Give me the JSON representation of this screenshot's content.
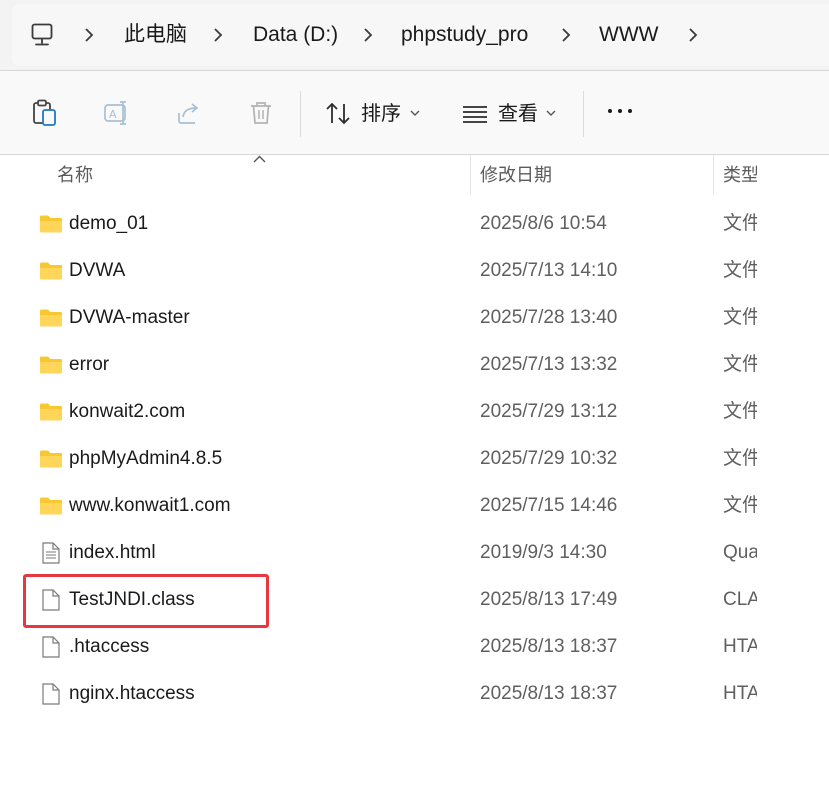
{
  "breadcrumb": {
    "items": [
      "此电脑",
      "Data (D:)",
      "phpstudy_pro",
      "WWW"
    ]
  },
  "toolbar": {
    "sort_label": "排序",
    "view_label": "查看"
  },
  "columns": {
    "name": "名称",
    "modified": "修改日期",
    "type": "类型"
  },
  "files": [
    {
      "name": "demo_01",
      "modified": "2025/8/6 10:54",
      "type": "文件",
      "kind": "folder"
    },
    {
      "name": "DVWA",
      "modified": "2025/7/13 14:10",
      "type": "文件",
      "kind": "folder"
    },
    {
      "name": "DVWA-master",
      "modified": "2025/7/28 13:40",
      "type": "文件",
      "kind": "folder"
    },
    {
      "name": "error",
      "modified": "2025/7/13 13:32",
      "type": "文件",
      "kind": "folder"
    },
    {
      "name": "konwait2.com",
      "modified": "2025/7/29 13:12",
      "type": "文件",
      "kind": "folder"
    },
    {
      "name": "phpMyAdmin4.8.5",
      "modified": "2025/7/29 10:32",
      "type": "文件",
      "kind": "folder"
    },
    {
      "name": "www.konwait1.com",
      "modified": "2025/7/15 14:46",
      "type": "文件",
      "kind": "folder"
    },
    {
      "name": "index.html",
      "modified": "2019/9/3 14:30",
      "type": "Qua",
      "kind": "file-lines"
    },
    {
      "name": "TestJNDI.class",
      "modified": "2025/8/13 17:49",
      "type": "CLA",
      "kind": "file",
      "highlighted": true
    },
    {
      "name": ".htaccess",
      "modified": "2025/8/13 18:37",
      "type": "HTA",
      "kind": "file"
    },
    {
      "name": "nginx.htaccess",
      "modified": "2025/8/13 18:37",
      "type": "HTA",
      "kind": "file"
    }
  ],
  "colors": {
    "folder": "#f8c832",
    "highlight_border": "#e8383d",
    "accent": "#1a1a1a"
  }
}
